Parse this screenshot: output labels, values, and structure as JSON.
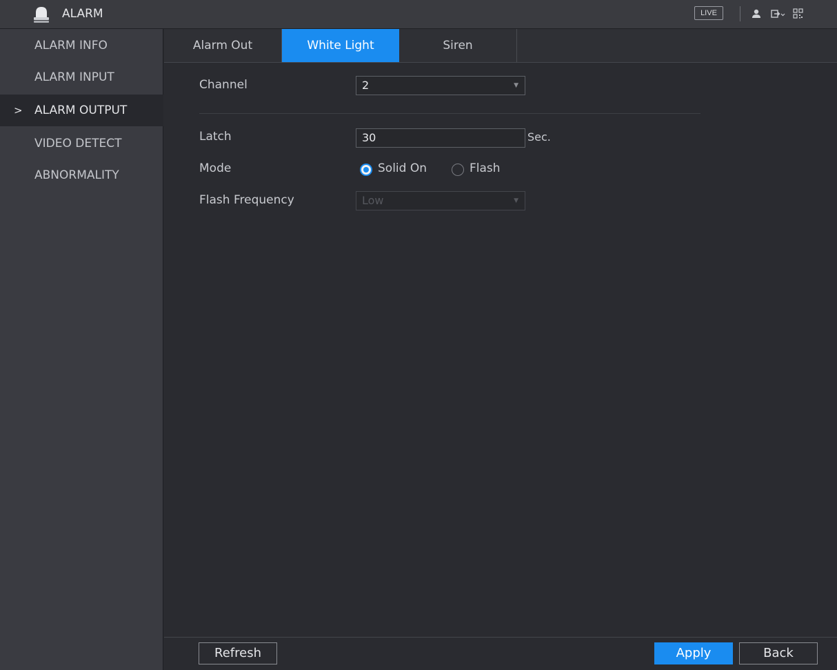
{
  "titlebar": {
    "title": "ALARM",
    "app_icon": "alarm-bell-icon",
    "live_label": "LIVE",
    "icons": [
      "user-icon",
      "logout-icon",
      "qr-code-icon"
    ]
  },
  "sidebar": {
    "items": [
      {
        "label": "ALARM INFO",
        "active": false
      },
      {
        "label": "ALARM INPUT",
        "active": false
      },
      {
        "label": "ALARM OUTPUT",
        "active": true
      },
      {
        "label": "VIDEO DETECT",
        "active": false
      },
      {
        "label": "ABNORMALITY",
        "active": false
      }
    ],
    "active_marker": ">"
  },
  "tabs": [
    {
      "label": "Alarm Out",
      "active": false
    },
    {
      "label": "White Light",
      "active": true
    },
    {
      "label": "Siren",
      "active": false
    }
  ],
  "form": {
    "channel_label": "Channel",
    "channel_value": "2",
    "latch_label": "Latch",
    "latch_value": "30",
    "latch_unit": "Sec.",
    "mode_label": "Mode",
    "mode_options": [
      {
        "label": "Solid On",
        "selected": true
      },
      {
        "label": "Flash",
        "selected": false
      }
    ],
    "flash_frequency_label": "Flash Frequency",
    "flash_frequency_value": "Low",
    "flash_frequency_disabled": true
  },
  "footer": {
    "refresh_label": "Refresh",
    "apply_label": "Apply",
    "back_label": "Back"
  },
  "colors": {
    "accent": "#1a8cf0",
    "background": "#2a2b30",
    "sidebar": "#3a3b41"
  }
}
